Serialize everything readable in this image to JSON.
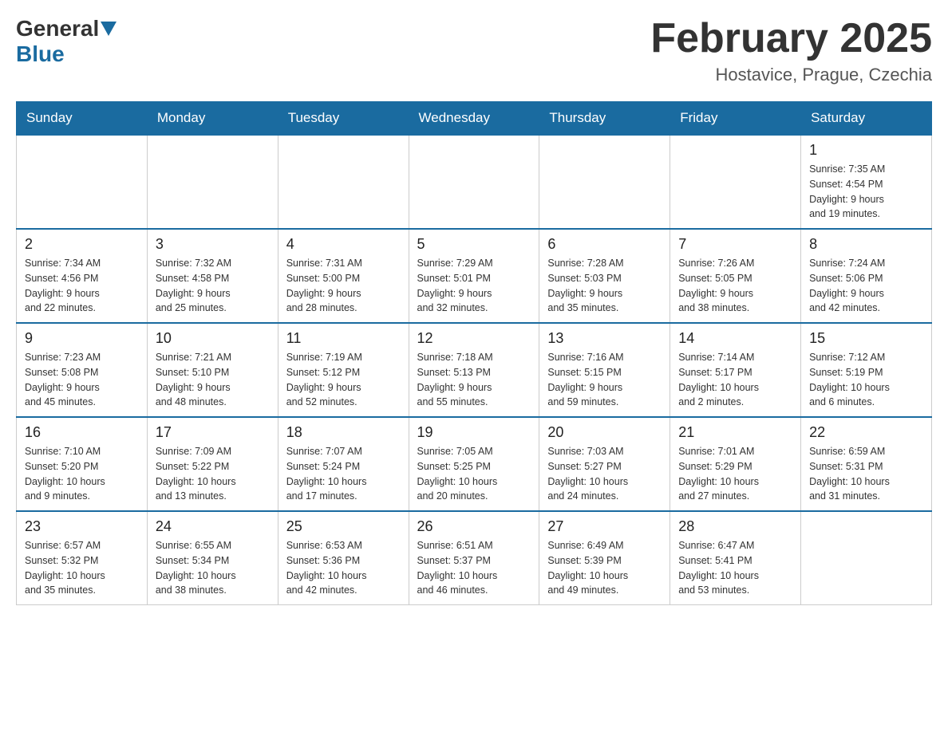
{
  "header": {
    "logo": {
      "general": "General",
      "blue": "Blue"
    },
    "title": "February 2025",
    "location": "Hostavice, Prague, Czechia"
  },
  "days_of_week": [
    "Sunday",
    "Monday",
    "Tuesday",
    "Wednesday",
    "Thursday",
    "Friday",
    "Saturday"
  ],
  "weeks": [
    {
      "days": [
        {
          "num": "",
          "info": "",
          "empty": true
        },
        {
          "num": "",
          "info": "",
          "empty": true
        },
        {
          "num": "",
          "info": "",
          "empty": true
        },
        {
          "num": "",
          "info": "",
          "empty": true
        },
        {
          "num": "",
          "info": "",
          "empty": true
        },
        {
          "num": "",
          "info": "",
          "empty": true
        },
        {
          "num": "1",
          "info": "Sunrise: 7:35 AM\nSunset: 4:54 PM\nDaylight: 9 hours\nand 19 minutes.",
          "empty": false
        }
      ]
    },
    {
      "days": [
        {
          "num": "2",
          "info": "Sunrise: 7:34 AM\nSunset: 4:56 PM\nDaylight: 9 hours\nand 22 minutes.",
          "empty": false
        },
        {
          "num": "3",
          "info": "Sunrise: 7:32 AM\nSunset: 4:58 PM\nDaylight: 9 hours\nand 25 minutes.",
          "empty": false
        },
        {
          "num": "4",
          "info": "Sunrise: 7:31 AM\nSunset: 5:00 PM\nDaylight: 9 hours\nand 28 minutes.",
          "empty": false
        },
        {
          "num": "5",
          "info": "Sunrise: 7:29 AM\nSunset: 5:01 PM\nDaylight: 9 hours\nand 32 minutes.",
          "empty": false
        },
        {
          "num": "6",
          "info": "Sunrise: 7:28 AM\nSunset: 5:03 PM\nDaylight: 9 hours\nand 35 minutes.",
          "empty": false
        },
        {
          "num": "7",
          "info": "Sunrise: 7:26 AM\nSunset: 5:05 PM\nDaylight: 9 hours\nand 38 minutes.",
          "empty": false
        },
        {
          "num": "8",
          "info": "Sunrise: 7:24 AM\nSunset: 5:06 PM\nDaylight: 9 hours\nand 42 minutes.",
          "empty": false
        }
      ]
    },
    {
      "days": [
        {
          "num": "9",
          "info": "Sunrise: 7:23 AM\nSunset: 5:08 PM\nDaylight: 9 hours\nand 45 minutes.",
          "empty": false
        },
        {
          "num": "10",
          "info": "Sunrise: 7:21 AM\nSunset: 5:10 PM\nDaylight: 9 hours\nand 48 minutes.",
          "empty": false
        },
        {
          "num": "11",
          "info": "Sunrise: 7:19 AM\nSunset: 5:12 PM\nDaylight: 9 hours\nand 52 minutes.",
          "empty": false
        },
        {
          "num": "12",
          "info": "Sunrise: 7:18 AM\nSunset: 5:13 PM\nDaylight: 9 hours\nand 55 minutes.",
          "empty": false
        },
        {
          "num": "13",
          "info": "Sunrise: 7:16 AM\nSunset: 5:15 PM\nDaylight: 9 hours\nand 59 minutes.",
          "empty": false
        },
        {
          "num": "14",
          "info": "Sunrise: 7:14 AM\nSunset: 5:17 PM\nDaylight: 10 hours\nand 2 minutes.",
          "empty": false
        },
        {
          "num": "15",
          "info": "Sunrise: 7:12 AM\nSunset: 5:19 PM\nDaylight: 10 hours\nand 6 minutes.",
          "empty": false
        }
      ]
    },
    {
      "days": [
        {
          "num": "16",
          "info": "Sunrise: 7:10 AM\nSunset: 5:20 PM\nDaylight: 10 hours\nand 9 minutes.",
          "empty": false
        },
        {
          "num": "17",
          "info": "Sunrise: 7:09 AM\nSunset: 5:22 PM\nDaylight: 10 hours\nand 13 minutes.",
          "empty": false
        },
        {
          "num": "18",
          "info": "Sunrise: 7:07 AM\nSunset: 5:24 PM\nDaylight: 10 hours\nand 17 minutes.",
          "empty": false
        },
        {
          "num": "19",
          "info": "Sunrise: 7:05 AM\nSunset: 5:25 PM\nDaylight: 10 hours\nand 20 minutes.",
          "empty": false
        },
        {
          "num": "20",
          "info": "Sunrise: 7:03 AM\nSunset: 5:27 PM\nDaylight: 10 hours\nand 24 minutes.",
          "empty": false
        },
        {
          "num": "21",
          "info": "Sunrise: 7:01 AM\nSunset: 5:29 PM\nDaylight: 10 hours\nand 27 minutes.",
          "empty": false
        },
        {
          "num": "22",
          "info": "Sunrise: 6:59 AM\nSunset: 5:31 PM\nDaylight: 10 hours\nand 31 minutes.",
          "empty": false
        }
      ]
    },
    {
      "days": [
        {
          "num": "23",
          "info": "Sunrise: 6:57 AM\nSunset: 5:32 PM\nDaylight: 10 hours\nand 35 minutes.",
          "empty": false
        },
        {
          "num": "24",
          "info": "Sunrise: 6:55 AM\nSunset: 5:34 PM\nDaylight: 10 hours\nand 38 minutes.",
          "empty": false
        },
        {
          "num": "25",
          "info": "Sunrise: 6:53 AM\nSunset: 5:36 PM\nDaylight: 10 hours\nand 42 minutes.",
          "empty": false
        },
        {
          "num": "26",
          "info": "Sunrise: 6:51 AM\nSunset: 5:37 PM\nDaylight: 10 hours\nand 46 minutes.",
          "empty": false
        },
        {
          "num": "27",
          "info": "Sunrise: 6:49 AM\nSunset: 5:39 PM\nDaylight: 10 hours\nand 49 minutes.",
          "empty": false
        },
        {
          "num": "28",
          "info": "Sunrise: 6:47 AM\nSunset: 5:41 PM\nDaylight: 10 hours\nand 53 minutes.",
          "empty": false
        },
        {
          "num": "",
          "info": "",
          "empty": true
        }
      ]
    }
  ]
}
